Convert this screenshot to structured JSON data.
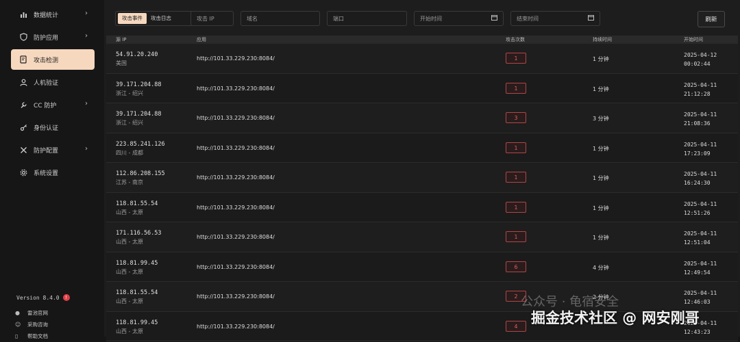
{
  "sidebar": {
    "items": [
      {
        "label": "数据统计",
        "icon": "bar-chart-icon",
        "has_submenu": true,
        "active": false
      },
      {
        "label": "防护应用",
        "icon": "shield-icon",
        "has_submenu": true,
        "active": false
      },
      {
        "label": "攻击检测",
        "icon": "document-search-icon",
        "has_submenu": false,
        "active": true
      },
      {
        "label": "人机验证",
        "icon": "user-check-icon",
        "has_submenu": false,
        "active": false
      },
      {
        "label": "CC 防护",
        "icon": "wrench-icon",
        "has_submenu": true,
        "active": false
      },
      {
        "label": "身份认证",
        "icon": "key-icon",
        "has_submenu": false,
        "active": false
      },
      {
        "label": "防护配置",
        "icon": "tools-icon",
        "has_submenu": true,
        "active": false
      },
      {
        "label": "系统设置",
        "icon": "gear-icon",
        "has_submenu": false,
        "active": false
      }
    ],
    "version": "Version 8.4.0",
    "version_badge": "!",
    "links": [
      {
        "label": "雷池官网",
        "icon": "logo-icon"
      },
      {
        "label": "采购咨询",
        "icon": "chat-icon"
      },
      {
        "label": "帮助文档",
        "icon": "doc-icon"
      }
    ]
  },
  "toolbar": {
    "tabs": [
      {
        "label": "攻击事件",
        "active": true
      },
      {
        "label": "攻击日志",
        "active": false
      }
    ],
    "ip_placeholder": "攻击 IP",
    "domain_placeholder": "域名",
    "port_placeholder": "端口",
    "start_placeholder": "开始时间",
    "end_placeholder": "结束时间",
    "refresh_label": "刷新"
  },
  "table": {
    "headers": {
      "ip": "源 IP",
      "app": "应用",
      "count": "攻击次数",
      "duration": "持续时间",
      "start": "开始时间"
    },
    "rows": [
      {
        "ip": "54.91.20.240",
        "loc": "美国",
        "app": "http://101.33.229.230:8084/",
        "count": "1",
        "duration": "1 分钟",
        "date": "2025-04-12",
        "time": "00:02:44"
      },
      {
        "ip": "39.171.204.88",
        "loc": "浙江 - 绍兴",
        "app": "http://101.33.229.230:8084/",
        "count": "1",
        "duration": "1 分钟",
        "date": "2025-04-11",
        "time": "21:12:28"
      },
      {
        "ip": "39.171.204.88",
        "loc": "浙江 - 绍兴",
        "app": "http://101.33.229.230:8084/",
        "count": "3",
        "duration": "3 分钟",
        "date": "2025-04-11",
        "time": "21:08:36"
      },
      {
        "ip": "223.85.241.126",
        "loc": "四川 - 成都",
        "app": "http://101.33.229.230:8084/",
        "count": "1",
        "duration": "1 分钟",
        "date": "2025-04-11",
        "time": "17:23:09"
      },
      {
        "ip": "112.86.208.155",
        "loc": "江苏 - 南京",
        "app": "http://101.33.229.230:8084/",
        "count": "1",
        "duration": "1 分钟",
        "date": "2025-04-11",
        "time": "16:24:30"
      },
      {
        "ip": "118.81.55.54",
        "loc": "山西 - 太原",
        "app": "http://101.33.229.230:8084/",
        "count": "1",
        "duration": "1 分钟",
        "date": "2025-04-11",
        "time": "12:51:26"
      },
      {
        "ip": "171.116.56.53",
        "loc": "山西 - 太原",
        "app": "http://101.33.229.230:8084/",
        "count": "1",
        "duration": "1 分钟",
        "date": "2025-04-11",
        "time": "12:51:04"
      },
      {
        "ip": "118.81.99.45",
        "loc": "山西 - 太原",
        "app": "http://101.33.229.230:8084/",
        "count": "6",
        "duration": "4 分钟",
        "date": "2025-04-11",
        "time": "12:49:54"
      },
      {
        "ip": "118.81.55.54",
        "loc": "山西 - 太原",
        "app": "http://101.33.229.230:8084/",
        "count": "2",
        "duration": "2 分钟",
        "date": "2025-04-11",
        "time": "12:46:03"
      },
      {
        "ip": "118.81.99.45",
        "loc": "山西 - 太原",
        "app": "http://101.33.229.230:8084/",
        "count": "4",
        "duration": "",
        "date": "2025-04-11",
        "time": "12:43:23"
      }
    ]
  },
  "watermark": {
    "line1": "公众号 · 龟宿安全",
    "line2": "掘金技术社区 @ 网安刚哥"
  },
  "colors": {
    "accent": "#f6d8bf",
    "danger": "#e86060",
    "background": "#161616",
    "panel": "#1d1d1d"
  }
}
